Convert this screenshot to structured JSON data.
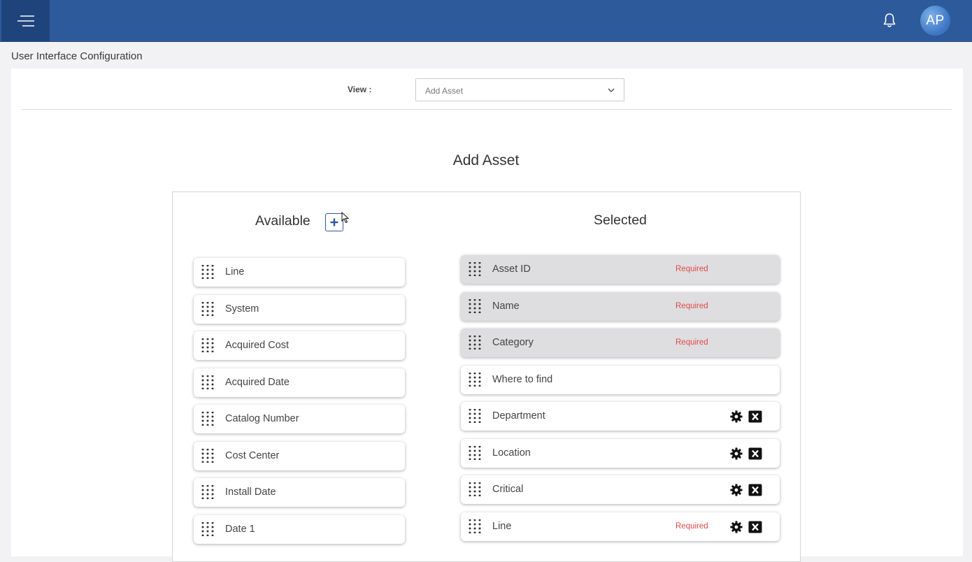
{
  "header": {
    "menu_icon": "hamburger-icon",
    "notification_icon": "bell-icon",
    "avatar_initials": "AP"
  },
  "page": {
    "title": "User Interface Configuration"
  },
  "view": {
    "label": "View :",
    "selected": "Add Asset"
  },
  "form": {
    "title": "Add Asset"
  },
  "available": {
    "title": "Available",
    "add_icon": "plus-icon",
    "items": [
      "Line",
      "System",
      "Acquired Cost",
      "Acquired Date",
      "Catalog Number",
      "Cost Center",
      "Install Date",
      "Date 1"
    ]
  },
  "selected": {
    "title": "Selected",
    "items": [
      {
        "label": "Asset ID",
        "required": "Required",
        "locked": true,
        "actions": false
      },
      {
        "label": "Name",
        "required": "Required",
        "locked": true,
        "actions": false
      },
      {
        "label": "Category",
        "required": "Required",
        "locked": true,
        "actions": false
      },
      {
        "label": "Where to find",
        "required": "",
        "locked": false,
        "actions": false
      },
      {
        "label": "Department",
        "required": "",
        "locked": false,
        "actions": true
      },
      {
        "label": "Location",
        "required": "",
        "locked": false,
        "actions": true
      },
      {
        "label": "Critical",
        "required": "",
        "locked": false,
        "actions": true
      },
      {
        "label": "Line",
        "required": "Required",
        "locked": false,
        "actions": true
      }
    ]
  },
  "colors": {
    "header_bg": "#2d5a9b",
    "menu_bg": "#1f447c",
    "accent": "#2d5a9b",
    "required": "#e14a4a",
    "locked_item_bg": "#dedee0"
  }
}
